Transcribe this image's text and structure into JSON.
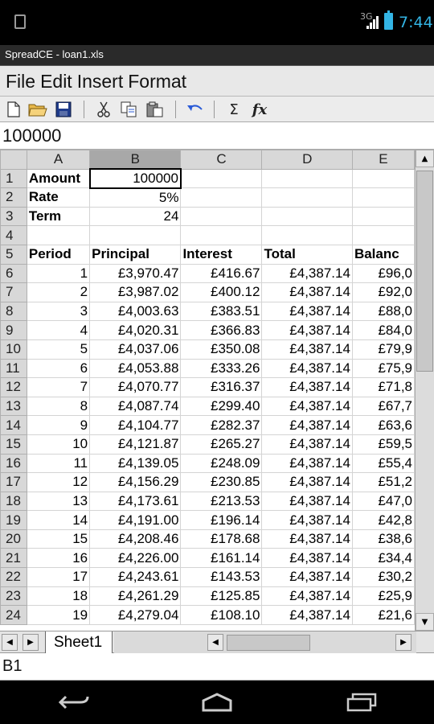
{
  "status_bar": {
    "network": "3G",
    "time": "7:44"
  },
  "window": {
    "title": "SpreadCE - loan1.xls"
  },
  "menu": [
    "File",
    "Edit",
    "Insert",
    "Format"
  ],
  "toolbar": {
    "icons": [
      "new-document-icon",
      "open-folder-icon",
      "save-icon",
      "cut-icon",
      "copy-icon",
      "paste-icon",
      "undo-icon",
      "sum-icon",
      "function-icon"
    ],
    "sum_glyph": "Σ",
    "function_glyph": "fx"
  },
  "formula_bar": {
    "value": "100000"
  },
  "grid": {
    "columns": [
      "A",
      "B",
      "C",
      "D",
      "E"
    ],
    "active_column": "B",
    "selected_cell": "B1",
    "rows": [
      {
        "n": "1",
        "A": "Amount",
        "B": "100000",
        "C": "",
        "D": "",
        "E": ""
      },
      {
        "n": "2",
        "A": "Rate",
        "B": "5%",
        "C": "",
        "D": "",
        "E": ""
      },
      {
        "n": "3",
        "A": "Term",
        "B": "24",
        "C": "",
        "D": "",
        "E": ""
      },
      {
        "n": "4",
        "A": "",
        "B": "",
        "C": "",
        "D": "",
        "E": ""
      },
      {
        "n": "5",
        "A": "Period",
        "B": "Principal",
        "C": "Interest",
        "D": "Total",
        "E": "Balanc"
      },
      {
        "n": "6",
        "A": "1",
        "B": "£3,970.47",
        "C": "£416.67",
        "D": "£4,387.14",
        "E": "£96,0"
      },
      {
        "n": "7",
        "A": "2",
        "B": "£3,987.02",
        "C": "£400.12",
        "D": "£4,387.14",
        "E": "£92,0"
      },
      {
        "n": "8",
        "A": "3",
        "B": "£4,003.63",
        "C": "£383.51",
        "D": "£4,387.14",
        "E": "£88,0"
      },
      {
        "n": "9",
        "A": "4",
        "B": "£4,020.31",
        "C": "£366.83",
        "D": "£4,387.14",
        "E": "£84,0"
      },
      {
        "n": "10",
        "A": "5",
        "B": "£4,037.06",
        "C": "£350.08",
        "D": "£4,387.14",
        "E": "£79,9"
      },
      {
        "n": "11",
        "A": "6",
        "B": "£4,053.88",
        "C": "£333.26",
        "D": "£4,387.14",
        "E": "£75,9"
      },
      {
        "n": "12",
        "A": "7",
        "B": "£4,070.77",
        "C": "£316.37",
        "D": "£4,387.14",
        "E": "£71,8"
      },
      {
        "n": "13",
        "A": "8",
        "B": "£4,087.74",
        "C": "£299.40",
        "D": "£4,387.14",
        "E": "£67,7"
      },
      {
        "n": "14",
        "A": "9",
        "B": "£4,104.77",
        "C": "£282.37",
        "D": "£4,387.14",
        "E": "£63,6"
      },
      {
        "n": "15",
        "A": "10",
        "B": "£4,121.87",
        "C": "£265.27",
        "D": "£4,387.14",
        "E": "£59,5"
      },
      {
        "n": "16",
        "A": "11",
        "B": "£4,139.05",
        "C": "£248.09",
        "D": "£4,387.14",
        "E": "£55,4"
      },
      {
        "n": "17",
        "A": "12",
        "B": "£4,156.29",
        "C": "£230.85",
        "D": "£4,387.14",
        "E": "£51,2"
      },
      {
        "n": "18",
        "A": "13",
        "B": "£4,173.61",
        "C": "£213.53",
        "D": "£4,387.14",
        "E": "£47,0"
      },
      {
        "n": "19",
        "A": "14",
        "B": "£4,191.00",
        "C": "£196.14",
        "D": "£4,387.14",
        "E": "£42,8"
      },
      {
        "n": "20",
        "A": "15",
        "B": "£4,208.46",
        "C": "£178.68",
        "D": "£4,387.14",
        "E": "£38,6"
      },
      {
        "n": "21",
        "A": "16",
        "B": "£4,226.00",
        "C": "£161.14",
        "D": "£4,387.14",
        "E": "£34,4"
      },
      {
        "n": "22",
        "A": "17",
        "B": "£4,243.61",
        "C": "£143.53",
        "D": "£4,387.14",
        "E": "£30,2"
      },
      {
        "n": "23",
        "A": "18",
        "B": "£4,261.29",
        "C": "£125.85",
        "D": "£4,387.14",
        "E": "£25,9"
      },
      {
        "n": "24",
        "A": "19",
        "B": "£4,279.04",
        "C": "£108.10",
        "D": "£4,387.14",
        "E": "£21,6"
      }
    ]
  },
  "sheet_tabs": [
    "Sheet1"
  ],
  "cell_reference": "B1",
  "colors": {
    "status_accent": "#33b5e5",
    "header_bg": "#d8d8d8",
    "active_header_bg": "#a8a8a8"
  }
}
